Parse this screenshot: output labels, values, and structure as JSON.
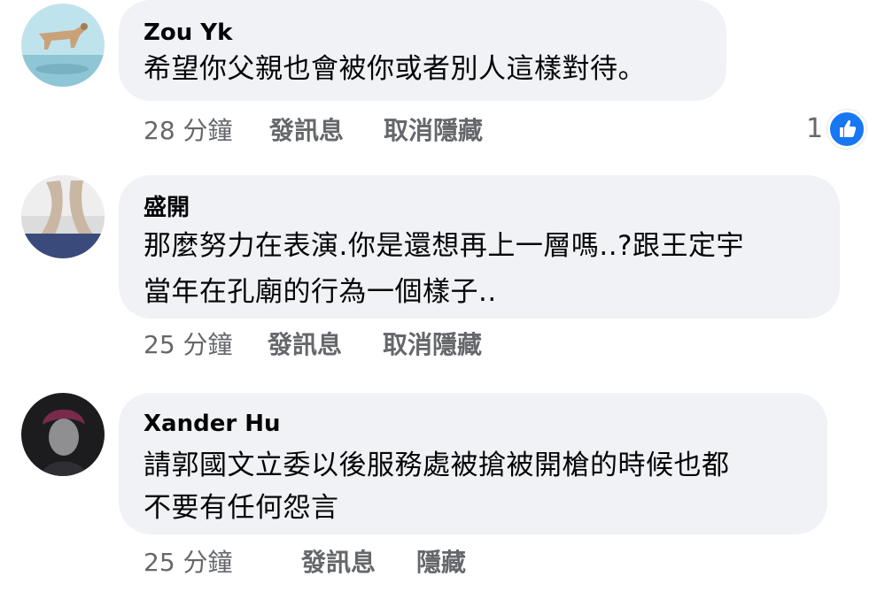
{
  "colors": {
    "bubble_bg": "#f0f2f5",
    "meta_text": "#65676b",
    "like_blue": "#1877f2"
  },
  "comments": [
    {
      "author": "Zou Yk",
      "lines": [
        "希望你父親也會被你或者別人這樣對待。"
      ],
      "time": "28 分鐘",
      "actions": [
        "發訊息",
        "取消隱藏"
      ],
      "reaction_count": "1",
      "reaction_icon": "thumbs-up-icon"
    },
    {
      "author": "盛開",
      "lines": [
        "那麼努力在表演.你是還想再上一層嗎..?跟王定宇",
        "當年在孔廟的行為一個樣子.."
      ],
      "time": "25 分鐘",
      "actions": [
        "發訊息",
        "取消隱藏"
      ]
    },
    {
      "author": "Xander Hu",
      "lines": [
        "請郭國文立委以後服務處被搶被開槍的時候也都",
        "不要有任何怨言"
      ],
      "time": "25 分鐘",
      "actions": [
        "發訊息",
        "隱藏"
      ]
    }
  ]
}
